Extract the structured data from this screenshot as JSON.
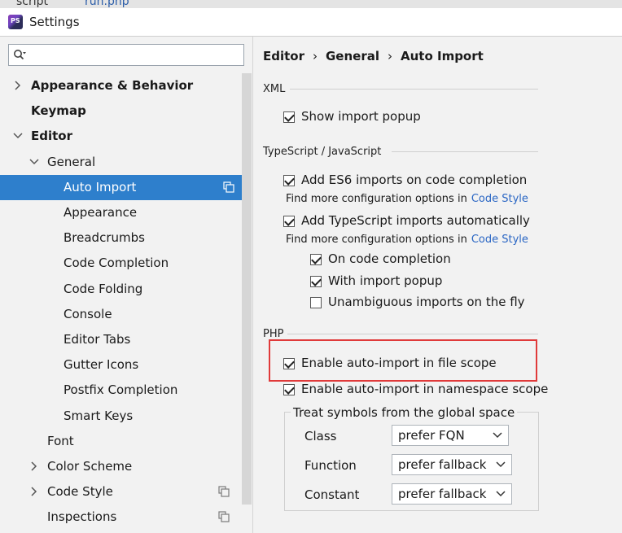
{
  "window": {
    "title": "Settings",
    "logo_text": "PS"
  },
  "top_tabs": [
    "script",
    "run.php"
  ],
  "search": {
    "placeholder": "",
    "value": ""
  },
  "tree": [
    {
      "label": "Appearance & Behavior",
      "bold": true,
      "chevron": "right",
      "indent": 0
    },
    {
      "label": "Keymap",
      "bold": true,
      "chevron": null,
      "indent": 0
    },
    {
      "label": "Editor",
      "bold": true,
      "chevron": "down",
      "indent": 0
    },
    {
      "label": "General",
      "bold": false,
      "chevron": "down",
      "indent": 1
    },
    {
      "label": "Auto Import",
      "bold": false,
      "chevron": null,
      "indent": 2,
      "selected": true,
      "copy_icon": true
    },
    {
      "label": "Appearance",
      "bold": false,
      "chevron": null,
      "indent": 2
    },
    {
      "label": "Breadcrumbs",
      "bold": false,
      "chevron": null,
      "indent": 2
    },
    {
      "label": "Code Completion",
      "bold": false,
      "chevron": null,
      "indent": 2
    },
    {
      "label": "Code Folding",
      "bold": false,
      "chevron": null,
      "indent": 2
    },
    {
      "label": "Console",
      "bold": false,
      "chevron": null,
      "indent": 2
    },
    {
      "label": "Editor Tabs",
      "bold": false,
      "chevron": null,
      "indent": 2
    },
    {
      "label": "Gutter Icons",
      "bold": false,
      "chevron": null,
      "indent": 2
    },
    {
      "label": "Postfix Completion",
      "bold": false,
      "chevron": null,
      "indent": 2
    },
    {
      "label": "Smart Keys",
      "bold": false,
      "chevron": null,
      "indent": 2
    },
    {
      "label": "Font",
      "bold": false,
      "chevron": null,
      "indent": 1
    },
    {
      "label": "Color Scheme",
      "bold": false,
      "chevron": "right",
      "indent": 1
    },
    {
      "label": "Code Style",
      "bold": false,
      "chevron": "right",
      "indent": 1,
      "copy_icon": true
    },
    {
      "label": "Inspections",
      "bold": false,
      "chevron": null,
      "indent": 1,
      "copy_icon": true
    }
  ],
  "breadcrumb": [
    "Editor",
    "General",
    "Auto Import"
  ],
  "xml": {
    "heading": "XML",
    "show_import_popup": {
      "label": "Show import popup",
      "checked": true
    }
  },
  "ts": {
    "heading": "TypeScript / JavaScript",
    "es6": {
      "label": "Add ES6 imports on code completion",
      "checked": true
    },
    "hint1": {
      "text": "Find more configuration options in",
      "link": "Code Style"
    },
    "ts_auto": {
      "label": "Add TypeScript imports automatically",
      "checked": true
    },
    "hint2": {
      "text": "Find more configuration options in",
      "link": "Code Style"
    },
    "on_completion": {
      "label": "On code completion",
      "checked": true
    },
    "with_popup": {
      "label": "With import popup",
      "checked": true
    },
    "unambiguous": {
      "label": "Unambiguous imports on the fly",
      "checked": false
    }
  },
  "php": {
    "heading": "PHP",
    "file_scope": {
      "label": "Enable auto-import in file scope",
      "checked": true
    },
    "ns_scope": {
      "label": "Enable auto-import in namespace scope",
      "checked": true
    },
    "group_title": "Treat symbols from the global space",
    "class": {
      "label": "Class",
      "value": "prefer FQN"
    },
    "function": {
      "label": "Function",
      "value": "prefer fallback"
    },
    "constant": {
      "label": "Constant",
      "value": "prefer fallback"
    }
  },
  "colors": {
    "selection": "#2e7fcc",
    "link": "#2a66c4",
    "highlight": "#e03a3a"
  }
}
